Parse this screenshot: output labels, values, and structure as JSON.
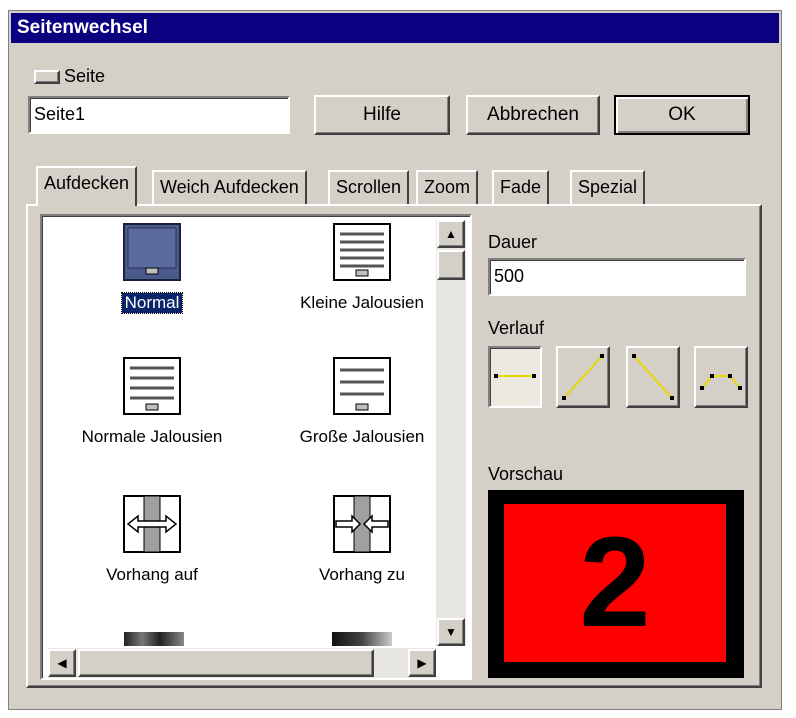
{
  "window": {
    "title": "Seitenwechsel"
  },
  "page_toggle": {
    "label": "Seite"
  },
  "page_name": {
    "value": "Seite1"
  },
  "buttons": {
    "help": "Hilfe",
    "cancel": "Abbrechen",
    "ok": "OK"
  },
  "tabs": [
    {
      "label": "Aufdecken",
      "active": true
    },
    {
      "label": "Weich Aufdecken",
      "active": false
    },
    {
      "label": "Scrollen",
      "active": false
    },
    {
      "label": "Zoom",
      "active": false
    },
    {
      "label": "Fade",
      "active": false
    },
    {
      "label": "Spezial",
      "active": false
    }
  ],
  "effects": [
    {
      "label": "Normal",
      "icon": "normal-icon",
      "selected": true
    },
    {
      "label": "Kleine Jalousien",
      "icon": "blinds-icon",
      "selected": false
    },
    {
      "label": "Normale  Jalousien",
      "icon": "blinds-icon",
      "selected": false
    },
    {
      "label": "Große  Jalousien",
      "icon": "blinds-icon",
      "selected": false
    },
    {
      "label": "Vorhang auf",
      "icon": "curtain-open-icon",
      "selected": false
    },
    {
      "label": "Vorhang zu",
      "icon": "curtain-close-icon",
      "selected": false
    }
  ],
  "duration": {
    "label": "Dauer",
    "value": "500"
  },
  "progression": {
    "label": "Verlauf",
    "options": [
      "linear-flat",
      "ascending",
      "descending",
      "arc"
    ],
    "selected": "linear-flat"
  },
  "preview": {
    "label": "Vorschau",
    "content": "2",
    "background": "#ff0000"
  },
  "colors": {
    "titlebar": "#0a0080",
    "selection": "#0a246a",
    "curve_line": "#e6d800"
  }
}
